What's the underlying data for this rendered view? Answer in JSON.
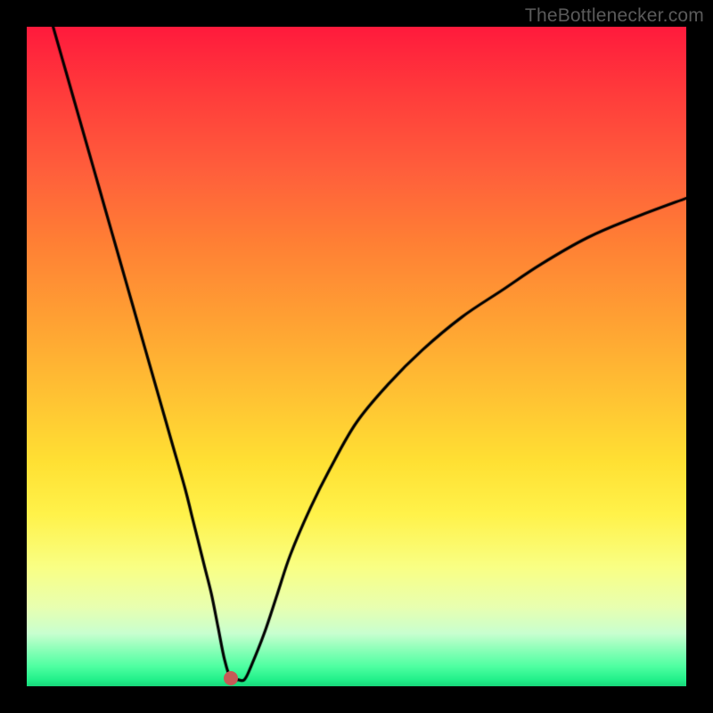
{
  "watermark": "TheBottleneсker.com",
  "chart_data": {
    "type": "line",
    "title": "",
    "xlabel": "",
    "ylabel": "",
    "xlim": [
      0,
      100
    ],
    "ylim": [
      0,
      100
    ],
    "grid": false,
    "series": [
      {
        "name": "bottleneck-curve",
        "x": [
          4,
          6,
          8,
          10,
          12,
          14,
          16,
          18,
          20,
          22,
          24,
          25,
          26,
          27,
          28,
          29,
          30,
          31,
          32,
          33,
          34,
          36,
          38,
          40,
          43,
          46,
          50,
          55,
          60,
          66,
          72,
          78,
          85,
          92,
          100
        ],
        "values": [
          100,
          93,
          86,
          79,
          72,
          65,
          58,
          51,
          44,
          37,
          30,
          26,
          22,
          18,
          14,
          9,
          4,
          1,
          1,
          1,
          3,
          8,
          14,
          20,
          27,
          33,
          40,
          46,
          51,
          56,
          60,
          64,
          68,
          71,
          74
        ]
      }
    ],
    "markers": [
      {
        "name": "optimal-point",
        "x": 31,
        "y": 1.2,
        "color": "#c65a57"
      }
    ],
    "gradient_colors": {
      "top": "#ff1a3c",
      "middle": "#ffe033",
      "bottom": "#18d67a"
    }
  }
}
